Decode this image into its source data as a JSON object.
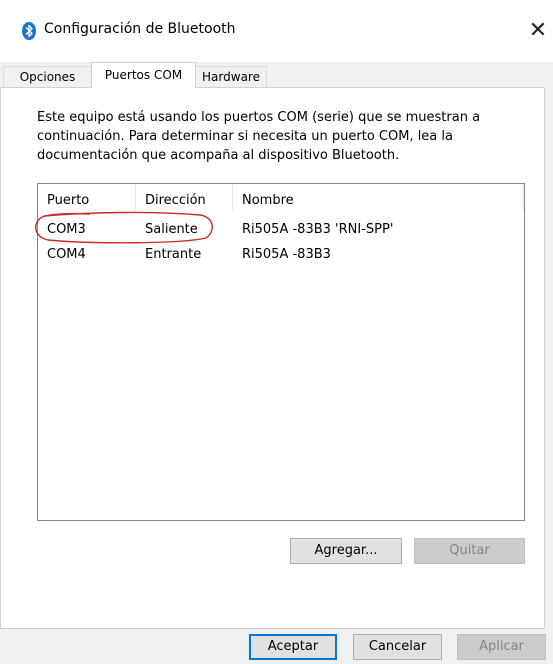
{
  "window": {
    "title": "Configuración de Bluetooth",
    "icon": "bluetooth-icon",
    "close_symbol": "✕"
  },
  "tabs": [
    {
      "label": "Opciones",
      "active": false
    },
    {
      "label": "Puertos COM",
      "active": true
    },
    {
      "label": "Hardware",
      "active": false
    }
  ],
  "description": "Este equipo está usando los puertos COM (serie) que se muestran a continuación. Para determinar si necesita un puerto COM, lea la documentación que acompaña al dispositivo Bluetooth.",
  "table": {
    "headers": [
      "Puerto",
      "Dirección",
      "Nombre"
    ],
    "rows": [
      [
        "COM3",
        "Saliente",
        "Ri505A  -83B3 'RNI-SPP'"
      ],
      [
        "COM4",
        "Entrante",
        "Ri505A  -83B3"
      ]
    ]
  },
  "buttons": {
    "add": "Agregar...",
    "remove": "Quitar",
    "ok": "Aceptar",
    "cancel": "Cancelar",
    "apply": "Aplicar"
  },
  "colors": {
    "accent": "#0078d7",
    "bluetooth": "#1a73c8",
    "annotation": "#cc2a2a"
  }
}
